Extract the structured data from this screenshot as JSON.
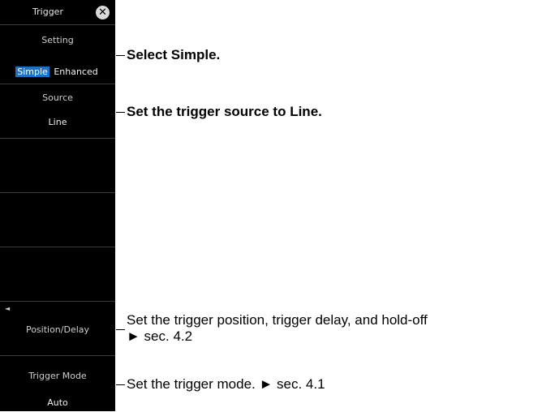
{
  "menu": {
    "title": "Trigger",
    "setting": {
      "label": "Setting",
      "options": [
        "Simple",
        "Enhanced"
      ],
      "selected": "Simple"
    },
    "source": {
      "label": "Source",
      "value": "Line"
    },
    "position_delay": {
      "label": "Position/Delay"
    },
    "trigger_mode": {
      "label": "Trigger Mode",
      "value": "Auto"
    },
    "colors": {
      "panel_bg": "#000000",
      "selected_bg": "#1a73c9",
      "text": "#e6e6e6"
    }
  },
  "annotations": {
    "setting": "Select Simple.",
    "source": "Set the trigger source to Line.",
    "position_line1": "Set the trigger position, trigger delay, and hold-off",
    "position_line2": "► sec. 4.2",
    "mode": "Set the trigger mode. ► sec. 4.1"
  }
}
